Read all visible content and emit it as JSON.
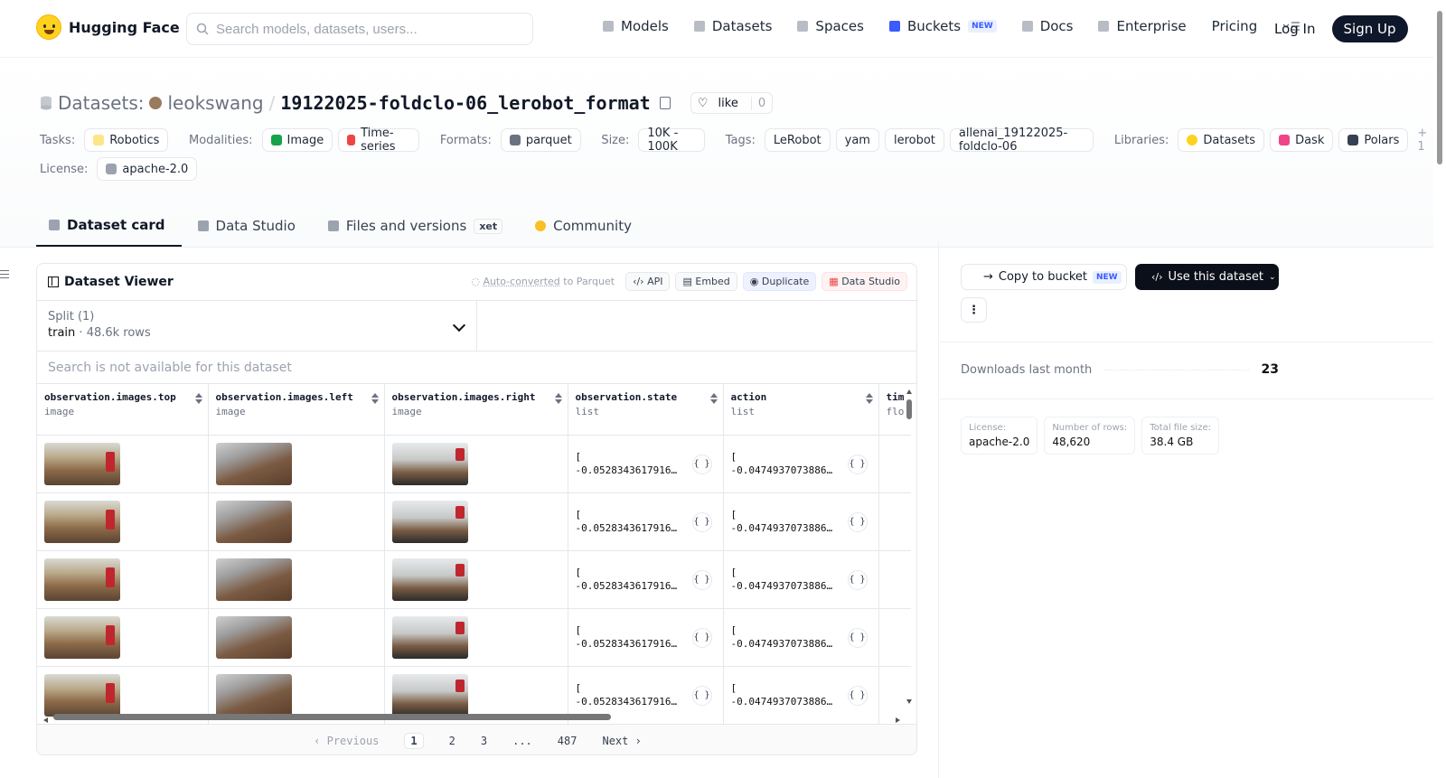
{
  "nav": {
    "brand": "Hugging Face",
    "search_placeholder": "Search models, datasets, users...",
    "links": [
      {
        "label": "Models",
        "icon": "cube-icon"
      },
      {
        "label": "Datasets",
        "icon": "database-icon"
      },
      {
        "label": "Spaces",
        "icon": "grid-icon"
      },
      {
        "label": "Buckets",
        "icon": "bucket-icon",
        "badge": "NEW"
      },
      {
        "label": "Docs",
        "icon": "book-icon"
      },
      {
        "label": "Enterprise",
        "icon": "enterprise-icon"
      },
      {
        "label": "Pricing"
      }
    ],
    "login": "Log In",
    "signup": "Sign Up"
  },
  "repo": {
    "type_label": "Datasets:",
    "owner": "leokswang",
    "separator": "/",
    "name": "19122025-foldclo-06_lerobot_format",
    "like_label": "like",
    "like_count": "0"
  },
  "tags": {
    "tasks_label": "Tasks:",
    "tasks": [
      "Robotics"
    ],
    "modalities_label": "Modalities:",
    "modalities": [
      "Image",
      "Time-series"
    ],
    "formats_label": "Formats:",
    "formats": [
      "parquet"
    ],
    "size_label": "Size:",
    "size": [
      "10K - 100K"
    ],
    "tags_label": "Tags:",
    "tag_values": [
      "LeRobot",
      "yam",
      "lerobot",
      "allenai_19122025-foldclo-06"
    ],
    "libraries_label": "Libraries:",
    "libraries": [
      "Datasets",
      "Dask",
      "Polars"
    ],
    "libraries_more": "+ 1",
    "license_label": "License:",
    "license": "apache-2.0"
  },
  "tabs": [
    {
      "label": "Dataset card",
      "active": true
    },
    {
      "label": "Data Studio"
    },
    {
      "label": "Files and versions",
      "badge": "xet"
    },
    {
      "label": "Community"
    }
  ],
  "viewer": {
    "title": "Dataset Viewer",
    "auto_converted_link": "Auto-converted",
    "auto_converted_suffix": "to Parquet",
    "buttons": [
      "API",
      "Embed",
      "Duplicate",
      "Data Studio"
    ],
    "split_label": "Split (1)",
    "split_name": "train",
    "split_rows": "48.6k rows",
    "search_na": "Search is not available for this dataset",
    "columns": [
      {
        "name": "observation.images.top",
        "dtype": "image"
      },
      {
        "name": "observation.images.left",
        "dtype": "image"
      },
      {
        "name": "observation.images.right",
        "dtype": "image"
      },
      {
        "name": "observation.state",
        "dtype": "list"
      },
      {
        "name": "action",
        "dtype": "list"
      },
      {
        "name": "tim",
        "dtype": "flo"
      }
    ],
    "rows": [
      {
        "state": "[\n-0.0528343617916…",
        "action": "[\n-0.0474937073886…"
      },
      {
        "state": "[\n-0.0528343617916…",
        "action": "[\n-0.0474937073886…"
      },
      {
        "state": "[\n-0.0528343617916…",
        "action": "[\n-0.0474937073886…"
      },
      {
        "state": "[\n-0.0528343617916…",
        "action": "[\n-0.0474937073886…"
      },
      {
        "state": "[\n-0.0528343617916…",
        "action": "[\n-0.0474937073886…"
      }
    ],
    "json_label": "{ }",
    "pager": {
      "previous": "Previous",
      "pages": [
        "1",
        "2",
        "3",
        "...",
        "487"
      ],
      "current": "1",
      "next": "Next"
    }
  },
  "sidebar": {
    "copy_bucket": "Copy to bucket",
    "copy_bucket_badge": "NEW",
    "use_dataset": "Use this dataset",
    "kebab": "⋮",
    "downloads_label": "Downloads last month",
    "downloads_value": "23",
    "stats": [
      {
        "k": "License:",
        "v": "apache-2.0"
      },
      {
        "k": "Number of rows:",
        "v": "48,620"
      },
      {
        "k": "Total file size:",
        "v": "38.4 GB"
      }
    ]
  },
  "colors": {
    "accent_blue": "#3b5bfd",
    "brand_yellow": "#ffd21e",
    "dark_button": "#0b0f19"
  }
}
